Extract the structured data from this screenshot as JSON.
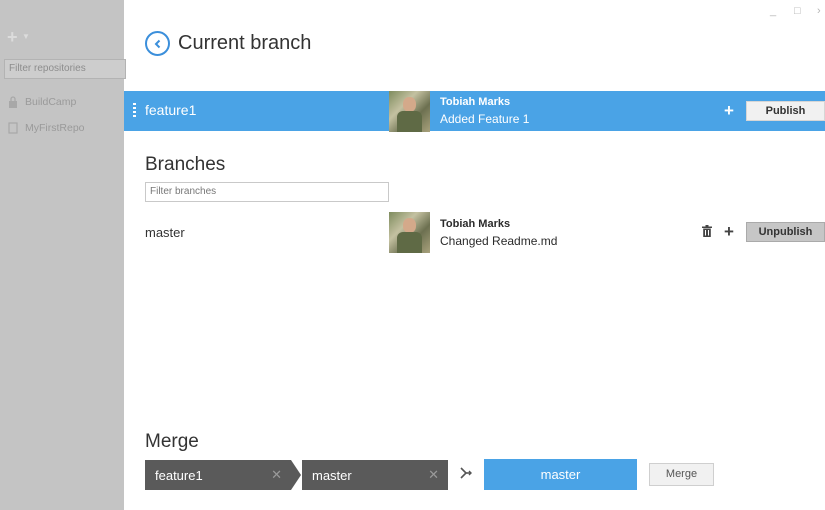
{
  "sidebar": {
    "filter_placeholder": "Filter repositories",
    "repos": [
      {
        "name": "BuildCamp",
        "icon": "lock-icon"
      },
      {
        "name": "MyFirstRepo",
        "icon": "repo-icon"
      }
    ]
  },
  "window": {
    "minimize": "_",
    "maximize": "□",
    "close": "›"
  },
  "header": {
    "title": "Current branch"
  },
  "current_branch": {
    "name": "feature1",
    "author": "Tobiah Marks",
    "message": "Added Feature 1",
    "publish_label": "Publish"
  },
  "branches": {
    "title": "Branches",
    "filter_placeholder": "Filter branches",
    "items": [
      {
        "name": "master",
        "author": "Tobiah Marks",
        "message": "Changed Readme.md",
        "unpublish_label": "Unpublish"
      }
    ]
  },
  "merge": {
    "title": "Merge",
    "from": "feature1",
    "to": "master",
    "target": "master",
    "button_label": "Merge"
  },
  "colors": {
    "accent": "#4aa3e6",
    "dark_chip": "#5a5a5a",
    "sidebar_dim": "#c4c4c4"
  }
}
